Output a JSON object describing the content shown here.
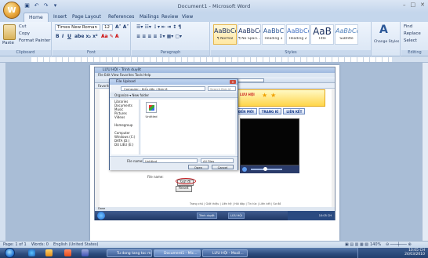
{
  "window": {
    "title": "Document1 - Microsoft Word",
    "office_button": "W"
  },
  "tabs": [
    "Home",
    "Insert",
    "Page Layout",
    "References",
    "Mailings",
    "Review",
    "View"
  ],
  "ribbon": {
    "clipboard": {
      "label": "Clipboard",
      "paste": "Paste",
      "cut": "Cut",
      "copy": "Copy",
      "format_painter": "Format Painter"
    },
    "font": {
      "label": "Font",
      "name": "Times New Roman",
      "size": "12"
    },
    "paragraph": {
      "label": "Paragraph"
    },
    "styles": {
      "label": "Styles",
      "items": [
        {
          "sample": "AaBbCcD",
          "name": "¶ Normal"
        },
        {
          "sample": "AaBbCcD",
          "name": "¶ No Spaci..."
        },
        {
          "sample": "AaBbC",
          "name": "Heading 1"
        },
        {
          "sample": "AaBbCc",
          "name": "Heading 2"
        },
        {
          "sample": "AaB",
          "name": "Title"
        },
        {
          "sample": "AaBbCc.",
          "name": "Subtitle"
        },
        {
          "sample": "AaBbCcL",
          "name": "Subtle Em..."
        },
        {
          "sample": "AaBbCcL",
          "name": "Emphasis"
        }
      ],
      "change_styles": "Change Styles"
    },
    "editing": {
      "label": "Editing",
      "find": "Find",
      "replace": "Replace",
      "select": "Select"
    }
  },
  "screenshot": {
    "ie_title": "LƯU HỘI - Trình duyệt",
    "ie_menu": "File  Edit  View  Favorites  Tools  Help",
    "ie_address": "http://www.luuhoi.vn/Tin-tuc/Video/index.aspx",
    "ie_search": "Live Search",
    "ie_favs": "Favorites",
    "site_nav": [
      "ĐỀN MỚI",
      "TRANG KÍ",
      "LIÊN KẾT"
    ],
    "site_banner": "LƯU HỘI",
    "file_label": "File name:",
    "browse": "Browse...",
    "submit": "Gửi đi",
    "reset": "Reset",
    "footer": "Trang chủ | Giới thiệu | Liên hệ | Hỏi đáp | Tin tức | Liên kết | Sơ đồ",
    "status": "Done",
    "inner_task_items": [
      "Trình duyệt",
      "LƯU HỘI"
    ],
    "inner_clock": "10:05 CH"
  },
  "dialog": {
    "title": "File Upload",
    "close": "×",
    "path": "Computer › Kiểu dấu › Đơn lẻ",
    "search": "Search Đơn lẻ",
    "toolbar": "Organize ▾    New folder",
    "tree": [
      "Libraries",
      "Documents",
      "Music",
      "Pictures",
      "Videos",
      "",
      "Homegroup",
      "",
      "Computer",
      "Windows (C:)",
      "DATA (D:)",
      "DU LIEU (E:)"
    ],
    "file_name": "Untitled",
    "filename_label": "File name:",
    "filename_value": "Untitled",
    "filter": "All Files",
    "open": "Open",
    "cancel": "Cancel"
  },
  "statusbar": {
    "page": "Page: 1 of 1",
    "words": "Words: 0",
    "language": "English (United States)",
    "zoom": "140%"
  },
  "taskbar": {
    "items": [
      {
        "label": "Tu dong tang toc mạng...",
        "active": false
      },
      {
        "label": "Document1 - Mic...",
        "active": true
      },
      {
        "label": "LƯU HỘI - Mozil...",
        "active": false
      }
    ],
    "clock_time": "10:05 CH",
    "clock_date": "24/03/2010"
  }
}
